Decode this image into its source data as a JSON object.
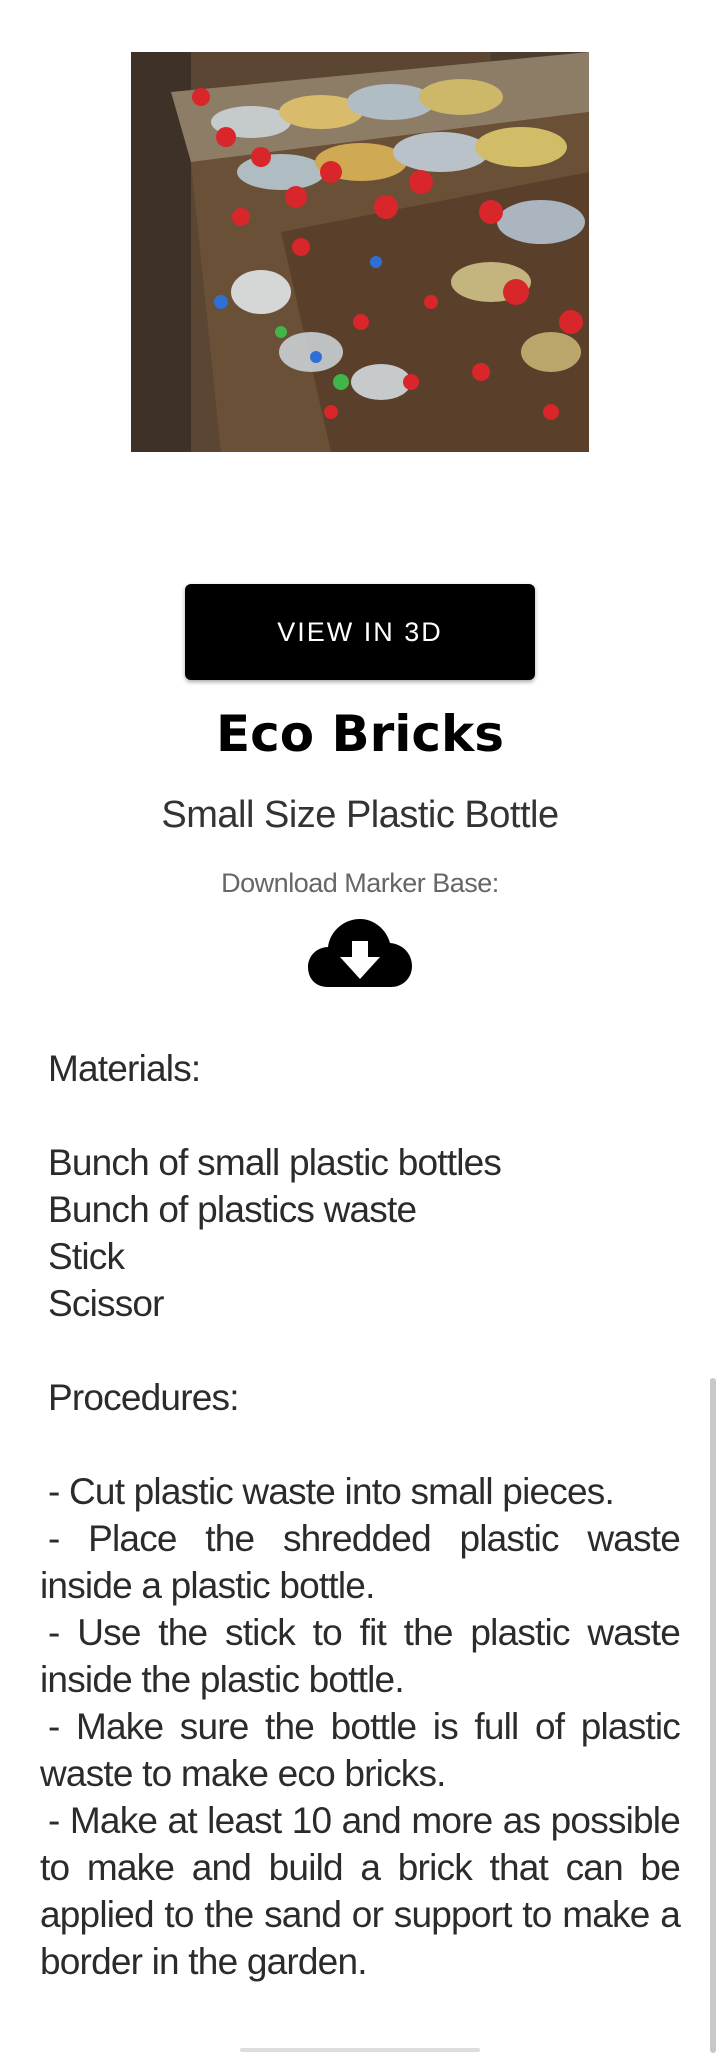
{
  "photo": {
    "icon": "eco-bricks-photo"
  },
  "view_button": {
    "label": "VIEW IN 3D"
  },
  "title": "Eco Bricks",
  "subtitle": "Small Size Plastic Bottle",
  "download": {
    "label": "Download Marker Base:",
    "icon": "cloud-download-icon"
  },
  "materials": {
    "heading": "Materials:",
    "items": [
      "Bunch of small plastic bottles",
      "Bunch of plastics waste",
      "Stick",
      "Scissor"
    ]
  },
  "procedures": {
    "heading": "Procedures:",
    "steps": [
      "- Cut plastic waste into small pieces.",
      "- Place the shredded plastic waste inside a plastic bottle.",
      "- Use the stick to fit the plastic waste inside the plastic bottle.",
      "- Make sure the bottle is full of plastic waste to make eco bricks.",
      "- Make at least 10 and more as possible to make and build a brick that can be applied to the sand or support to make a border in the garden."
    ]
  },
  "colors": {
    "button_bg": "#000000",
    "button_text": "#ffffff",
    "body_text": "#2b2b2b",
    "muted_text": "#666666"
  }
}
